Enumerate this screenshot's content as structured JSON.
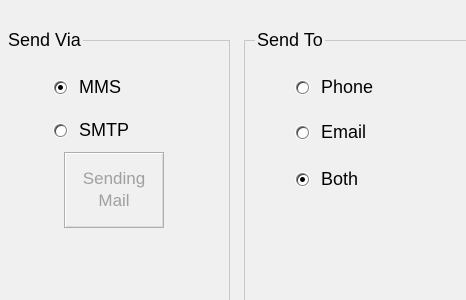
{
  "send_via": {
    "title": "Send Via",
    "options": [
      {
        "label": "MMS",
        "checked": true
      },
      {
        "label": "SMTP",
        "checked": false
      }
    ],
    "button_label": "Sending Mail"
  },
  "send_to": {
    "title": "Send To",
    "options": [
      {
        "label": "Phone",
        "checked": false
      },
      {
        "label": "Email",
        "checked": false
      },
      {
        "label": "Both",
        "checked": true
      }
    ]
  }
}
